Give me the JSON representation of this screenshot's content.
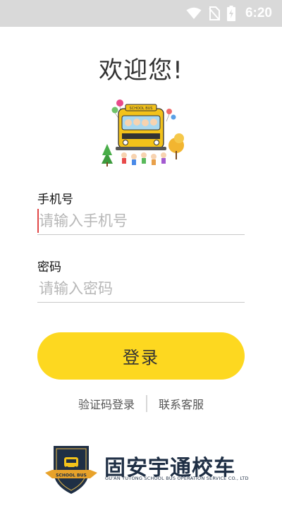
{
  "status_bar": {
    "time": "6:20",
    "icons": [
      "wifi-icon",
      "no-sim-icon",
      "battery-charging-icon"
    ]
  },
  "welcome": {
    "title": "欢迎您!"
  },
  "illustration": {
    "name": "school-bus-illustration",
    "bus_sign": "SCHOOL BUS"
  },
  "phone": {
    "label": "手机号",
    "placeholder": "请输入手机号",
    "value": ""
  },
  "password": {
    "label": "密码",
    "placeholder": "请输入密码",
    "value": ""
  },
  "login_button": {
    "label": "登录"
  },
  "links": {
    "sms_login": "验证码登录",
    "contact_service": "联系客服"
  },
  "brand": {
    "badge_text": "SCHOOL BUS",
    "name": "固安宇通校车",
    "subtitle": "GU'AN YUTONG SCHOOL BUS OPERATION SERVICE CO., LTD"
  },
  "colors": {
    "accent": "#fdd820",
    "status_bar": "#d9d9d9",
    "brand_navy": "#1f2f45"
  }
}
